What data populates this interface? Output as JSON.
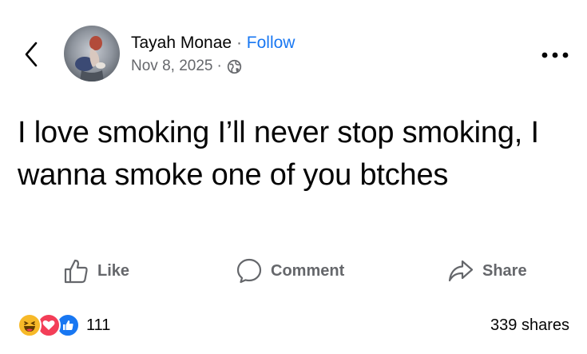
{
  "header": {
    "author": "Tayah Monae",
    "separator": "·",
    "follow_label": "Follow",
    "date": "Nov 8, 2025",
    "date_separator": "·",
    "audience_icon": "globe-icon"
  },
  "post": {
    "text": "I love smoking I’ll never stop smoking, I wanna smoke one of you btches"
  },
  "actions": {
    "like_label": "Like",
    "comment_label": "Comment",
    "share_label": "Share"
  },
  "stats": {
    "reactions": [
      "haha",
      "love",
      "like"
    ],
    "reaction_count": "111",
    "shares_text": "339 shares"
  },
  "colors": {
    "link_blue": "#1877f2",
    "secondary_text": "#65676b",
    "primary_text": "#050505",
    "love_red": "#f33e58",
    "haha_yellow": "#f7b928"
  }
}
